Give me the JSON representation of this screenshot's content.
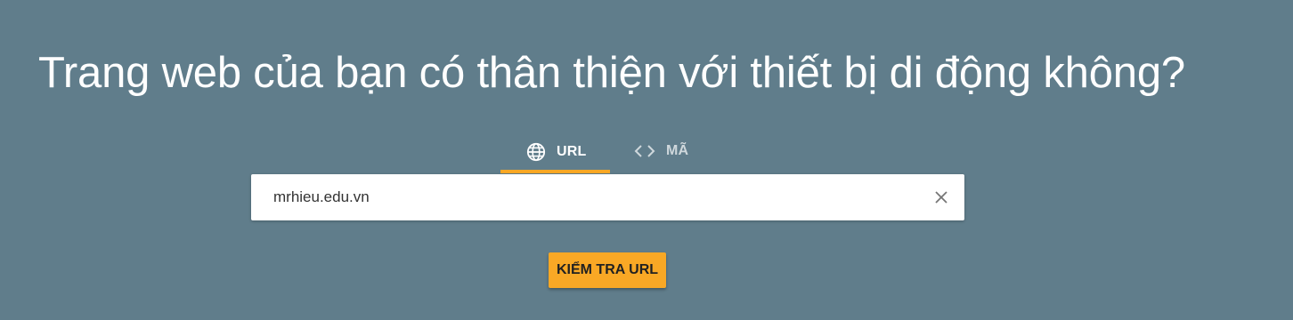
{
  "page": {
    "headline": "Trang web của bạn có thân thiện với thiết bị di động không?"
  },
  "tabs": [
    {
      "label": "URL",
      "icon": "globe-icon",
      "active": true
    },
    {
      "label": "MÃ",
      "icon": "code-icon",
      "active": false
    }
  ],
  "url_field": {
    "value": "mrhieu.edu.vn",
    "clear_icon": "close-icon"
  },
  "actions": {
    "test_button_label": "KIỂM TRA URL"
  },
  "colors": {
    "background": "#607d8b",
    "accent": "#f9a825",
    "input_bg": "#ffffff"
  }
}
